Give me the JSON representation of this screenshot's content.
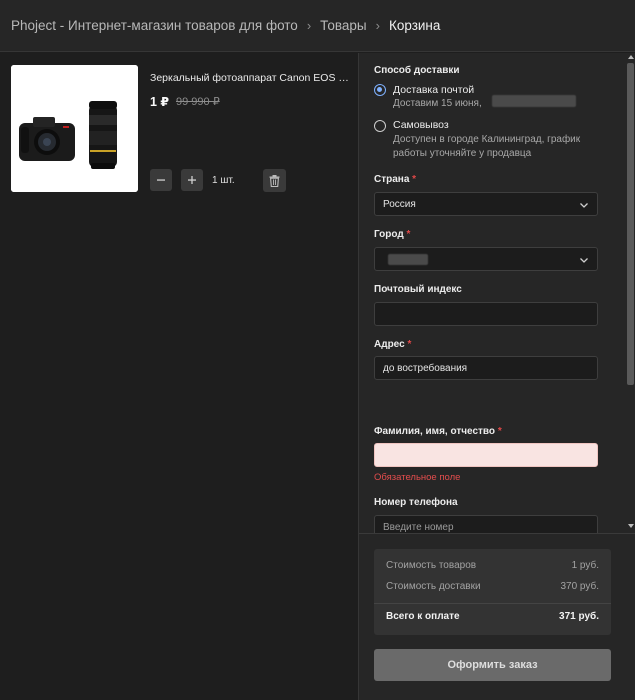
{
  "breadcrumb": {
    "items": [
      "Phoject - Интернет-магазин товаров для фото",
      "Товары",
      "Корзина"
    ]
  },
  "product": {
    "title": "Зеркальный фотоаппарат Canon EOS 8...",
    "price": "1 ₽",
    "old_price": "99 990 ₽",
    "quantity": "1 шт.",
    "icons": {
      "minus": "minus-icon",
      "plus": "plus-icon",
      "trash": "trash-icon",
      "image": "camera-lens-photo"
    }
  },
  "delivery": {
    "label": "Способ доставки",
    "options": [
      {
        "title": "Доставка почтой",
        "sub": "Доставим 15 июня,",
        "selected": true
      },
      {
        "title": "Самовывоз",
        "sub": "Доступен в городе Калининград, график работы уточняйте у продавца",
        "selected": false
      }
    ]
  },
  "form": {
    "country": {
      "label": "Страна",
      "required": "*",
      "value": "Россия"
    },
    "city": {
      "label": "Город",
      "required": "*",
      "value": ""
    },
    "postcode": {
      "label": "Почтовый индекс",
      "value": ""
    },
    "address": {
      "label": "Адрес",
      "required": "*",
      "value": "до востребования"
    },
    "fullname": {
      "label": "Фамилия, имя, отчество",
      "required": "*",
      "value": "",
      "error": "Обязательное поле"
    },
    "phone": {
      "label": "Номер телефона",
      "placeholder": "Введите номер"
    }
  },
  "summary": {
    "goods_label": "Стоимость товаров",
    "goods_value": "1 руб.",
    "delivery_label": "Стоимость доставки",
    "delivery_value": "370 руб.",
    "total_label": "Всего к оплате",
    "total_value": "371 руб.",
    "order_button": "Оформить заказ"
  },
  "colors": {
    "background": "#1e1e1e",
    "panel": "#262626",
    "accent_radio": "#7fb1ff",
    "error": "#e34d4d",
    "error_field_bg": "#f9e4e2"
  }
}
